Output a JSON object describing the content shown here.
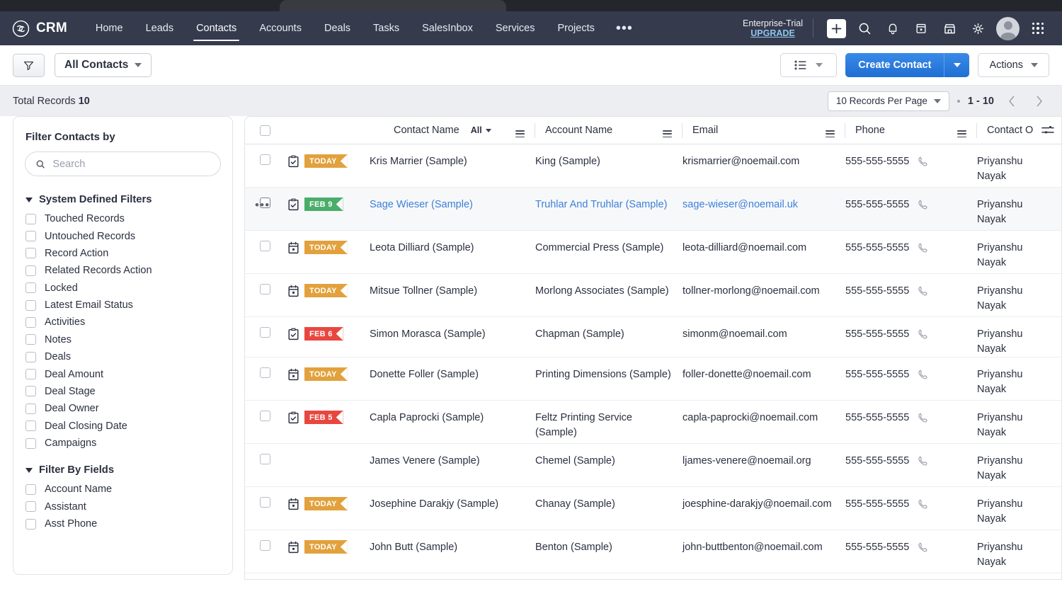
{
  "nav": {
    "brand": "CRM",
    "brand_icon": "crm-logo-icon",
    "links": [
      {
        "label": "Home",
        "active": false
      },
      {
        "label": "Leads",
        "active": false
      },
      {
        "label": "Contacts",
        "active": true
      },
      {
        "label": "Accounts",
        "active": false
      },
      {
        "label": "Deals",
        "active": false
      },
      {
        "label": "Tasks",
        "active": false
      },
      {
        "label": "SalesInbox",
        "active": false
      },
      {
        "label": "Services",
        "active": false
      },
      {
        "label": "Projects",
        "active": false
      }
    ],
    "more_label": "•••",
    "trial_name": "Enterprise-Trial",
    "trial_upgrade": "UPGRADE",
    "icons": [
      "plus-icon",
      "search-icon",
      "bell-icon",
      "calendar-icon",
      "store-icon",
      "gear-icon",
      "avatar",
      "apps-grid-icon"
    ]
  },
  "toolbar": {
    "filter_icon": "funnel-icon",
    "view_name": "All Contacts",
    "listview_icon": "list-view-icon",
    "create_label": "Create Contact",
    "actions_label": "Actions"
  },
  "recordbar": {
    "total_label": "Total Records",
    "total_count": "10",
    "per_page": "10 Records Per Page",
    "range": "1 - 10",
    "prev_icon": "chevron-left-icon",
    "next_icon": "chevron-right-icon"
  },
  "sidebar": {
    "title": "Filter Contacts by",
    "search_placeholder": "Search",
    "search_value": "",
    "groups": [
      {
        "label": "System Defined Filters",
        "items": [
          "Touched Records",
          "Untouched Records",
          "Record Action",
          "Related Records Action",
          "Locked",
          "Latest Email Status",
          "Activities",
          "Notes",
          "Deals",
          "Deal Amount",
          "Deal Stage",
          "Deal Owner",
          "Deal Closing Date",
          "Campaigns"
        ]
      },
      {
        "label": "Filter By Fields",
        "items": [
          "Account Name",
          "Assistant",
          "Asst Phone"
        ]
      }
    ]
  },
  "table": {
    "columns": [
      {
        "label": "Contact Name",
        "filter": "All"
      },
      {
        "label": "Account Name"
      },
      {
        "label": "Email"
      },
      {
        "label": "Phone"
      },
      {
        "label": "Contact O"
      }
    ],
    "settings_icon": "column-settings-icon",
    "rows": [
      {
        "activity_icon": "task-clipboard-icon",
        "badge": "TODAY",
        "badge_color": "#e2a13c",
        "name": "Kris Marrier (Sample)",
        "account": "King (Sample)",
        "email": "krismarrier@noemail.com",
        "phone": "555-555-5555",
        "owner": "Priyanshu Nayak",
        "hover": false,
        "link": false
      },
      {
        "activity_icon": "task-clipboard-icon",
        "badge": "FEB 9",
        "badge_color": "#4aad6a",
        "name": "Sage Wieser (Sample)",
        "account": "Truhlar And Truhlar (Sample)",
        "email": "sage-wieser@noemail.uk",
        "phone": "555-555-5555",
        "owner": "Priyanshu Nayak",
        "hover": true,
        "link": true
      },
      {
        "activity_icon": "event-calendar-icon",
        "badge": "TODAY",
        "badge_color": "#e2a13c",
        "name": "Leota Dilliard (Sample)",
        "account": "Commercial Press (Sample)",
        "email": "leota-dilliard@noemail.com",
        "phone": "555-555-5555",
        "owner": "Priyanshu Nayak",
        "hover": false,
        "link": false
      },
      {
        "activity_icon": "event-calendar-icon",
        "badge": "TODAY",
        "badge_color": "#e2a13c",
        "name": "Mitsue Tollner (Sample)",
        "account": "Morlong Associates (Sample)",
        "email": "tollner-morlong@noemail.com",
        "phone": "555-555-5555",
        "owner": "Priyanshu Nayak",
        "hover": false,
        "link": false
      },
      {
        "activity_icon": "task-clipboard-icon",
        "badge": "FEB 6",
        "badge_color": "#e8473f",
        "name": "Simon Morasca (Sample)",
        "account": "Chapman (Sample)",
        "email": "simonm@noemail.com",
        "phone": "555-555-5555",
        "owner": "Priyanshu Nayak",
        "hover": false,
        "link": false
      },
      {
        "activity_icon": "event-calendar-icon",
        "badge": "TODAY",
        "badge_color": "#e2a13c",
        "name": "Donette Foller (Sample)",
        "account": "Printing Dimensions (Sample)",
        "email": "foller-donette@noemail.com",
        "phone": "555-555-5555",
        "owner": "Priyanshu Nayak",
        "hover": false,
        "link": false
      },
      {
        "activity_icon": "task-clipboard-icon",
        "badge": "FEB 5",
        "badge_color": "#e8473f",
        "name": "Capla Paprocki (Sample)",
        "account": "Feltz Printing Service (Sample)",
        "email": "capla-paprocki@noemail.com",
        "phone": "555-555-5555",
        "owner": "Priyanshu Nayak",
        "hover": false,
        "link": false
      },
      {
        "activity_icon": "",
        "badge": "",
        "badge_color": "",
        "name": "James Venere (Sample)",
        "account": "Chemel (Sample)",
        "email": "ljames-venere@noemail.org",
        "phone": "555-555-5555",
        "owner": "Priyanshu Nayak",
        "hover": false,
        "link": false
      },
      {
        "activity_icon": "event-calendar-icon",
        "badge": "TODAY",
        "badge_color": "#e2a13c",
        "name": "Josephine Darakjy (Sample)",
        "account": "Chanay (Sample)",
        "email": "joesphine-darakjy@noemail.com",
        "phone": "555-555-5555",
        "owner": "Priyanshu Nayak",
        "hover": false,
        "link": false
      },
      {
        "activity_icon": "event-calendar-icon",
        "badge": "TODAY",
        "badge_color": "#e2a13c",
        "name": "John Butt (Sample)",
        "account": "Benton (Sample)",
        "email": "john-buttbenton@noemail.com",
        "phone": "555-555-5555",
        "owner": "Priyanshu Nayak",
        "hover": false,
        "link": false
      }
    ]
  },
  "colors": {
    "nav_bg": "#353b4d",
    "accent_blue": "#2a7de1",
    "link_blue": "#3d7fd8",
    "badge_today": "#e2a13c",
    "badge_green": "#4aad6a",
    "badge_red": "#e8473f"
  }
}
